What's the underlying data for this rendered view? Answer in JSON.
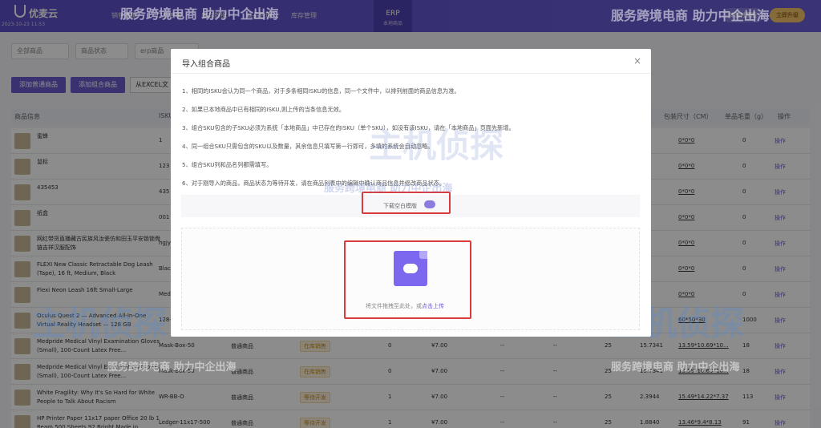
{
  "app": {
    "logo": "优麦云",
    "logo_sub": "2023-10-23 11:53"
  },
  "nav": {
    "items": [
      "销售数据",
      "广告管理",
      "库存数据",
      "商品管理",
      "库存管理"
    ],
    "erp_title": "ERP",
    "erp_sub": "本地商品",
    "right_buttons": [
      "体验付费版",
      "立即升级"
    ]
  },
  "filters": {
    "all_products": "全部商品",
    "product_status": "商品状态",
    "erp_product": "erp商品"
  },
  "actions": {
    "add_normal": "添加普通商品",
    "add_combo": "添加组合商品",
    "import_excel": "从EXCEL文"
  },
  "table": {
    "headers": {
      "info": "商品信息",
      "sku": "ISKU",
      "size": "包装尺寸（CM）",
      "gross": "单品毛重（g）",
      "op": "操作"
    },
    "rows": [
      {
        "name": "蜜蜂",
        "sku": "1",
        "type": "",
        "status": "",
        "qty": "",
        "price": "",
        "d1": "",
        "d2": "",
        "n": "",
        "w": "",
        "size": "0*0*0",
        "gross": "0",
        "op": "操作"
      },
      {
        "name": "鼠标",
        "sku": "123",
        "type": "",
        "status": "",
        "qty": "",
        "price": "",
        "d1": "",
        "d2": "",
        "n": "",
        "w": "",
        "size": "0*0*0",
        "gross": "0",
        "op": "操作"
      },
      {
        "name": "435453",
        "sku": "435",
        "type": "",
        "status": "",
        "qty": "",
        "price": "",
        "d1": "",
        "d2": "",
        "n": "",
        "w": "",
        "size": "0*0*0",
        "gross": "0",
        "op": "操作"
      },
      {
        "name": "纸盒",
        "sku": "001",
        "type": "",
        "status": "",
        "qty": "",
        "price": "",
        "d1": "",
        "d2": "",
        "n": "",
        "w": "",
        "size": "0*0*0",
        "gross": "0",
        "op": "操作"
      },
      {
        "name": "网红带货直播藏古民族风汝瓷仿和田玉平安锁锁骨链吉祥汉服配饰",
        "sku": "hgjy",
        "type": "",
        "status": "",
        "qty": "",
        "price": "",
        "d1": "",
        "d2": "",
        "n": "",
        "w": "",
        "size": "0*0*0",
        "gross": "0",
        "op": "操作"
      },
      {
        "name": "FLEXI New Classic Retractable Dog Leash (Tape), 16 ft, Medium, Black",
        "sku": "Black",
        "type": "",
        "status": "",
        "qty": "",
        "price": "",
        "d1": "",
        "d2": "",
        "n": "",
        "w": "",
        "size": "0*0*0",
        "gross": "0",
        "op": "操作"
      },
      {
        "name": "Flexi Neon Leash 16ft Small-Large",
        "sku": "Med",
        "type": "",
        "status": "",
        "qty": "",
        "price": "",
        "d1": "",
        "d2": "",
        "n": "",
        "w": "",
        "size": "0*0*0",
        "gross": "0",
        "op": "操作"
      },
      {
        "name": "Oculus Quest 2 — Advanced All-In-One Virtual Reality Headset — 128 GB",
        "sku": "128-",
        "type": "",
        "status": "",
        "qty": "",
        "price": "",
        "d1": "",
        "d2": "",
        "n": "",
        "w": "",
        "size": "60*50*30",
        "gross": "1000",
        "op": "操作"
      },
      {
        "name": "Medpride Medical Vinyl Examination Gloves (Small), 100-Count Latex Free...",
        "sku": "Mask-Box-50",
        "type": "普通商品",
        "status": "在库销售",
        "qty": "0",
        "price": "¥7.00",
        "d1": "--",
        "d2": "--",
        "n": "25",
        "w": "15.7341",
        "size": "13.59*10.69*10...",
        "gross": "18",
        "op": "操作"
      },
      {
        "name": "Medpride Medical Vinyl Examination Gloves (Small), 100-Count Latex Free...",
        "sku": "Mask-Box-50",
        "type": "普通商品",
        "status": "在库销售",
        "qty": "0",
        "price": "¥7.00",
        "d1": "--",
        "d2": "--",
        "n": "25",
        "w": "15.7341",
        "size": "13.59*10.69*10...",
        "gross": "18",
        "op": "操作"
      },
      {
        "name": "White Fragility: Why It's So Hard for White People to Talk About Racism",
        "sku": "WR-BB-O",
        "type": "普通商品",
        "status": "等待开发",
        "qty": "1",
        "price": "¥7.00",
        "d1": "--",
        "d2": "--",
        "n": "25",
        "w": "2.3944",
        "size": "15.49*14.22*7.37",
        "gross": "113",
        "op": "操作"
      },
      {
        "name": "HP Printer Paper 11x17 paper Office 20 lb 1 Ream 500 Sheets 92 Bright Made in...",
        "sku": "Ledger-11x17-500",
        "type": "普通商品",
        "status": "等待开发",
        "qty": "1",
        "price": "¥7.00",
        "d1": "--",
        "d2": "--",
        "n": "25",
        "w": "1.8840",
        "size": "13.46*9.4*8.13",
        "gross": "91",
        "op": "操作"
      }
    ]
  },
  "modal": {
    "title": "导入组合商品",
    "close": "×",
    "notes": [
      "1、相同的ISKU会认为同一个商品，对于多条相同ISKU的信息，同一个文件中，以排列前面的商品信息为准。",
      "2、如果已本地商品中已有相同的ISKU,则上传的当条信息无效。",
      "3、组合SKU包含的子SKU必须为系统「本地商品」中已存在的ISKU（单个SKU），如没有该ISKU，请在「本地商品」页面先新增。",
      "4、同一组合SKU只需包含的SKU以及数量，其余信息只填写第一行即可，多填的系统会自动忽略。",
      "5、组合SKU列和品名列都需填写。",
      "6、对于刚导入的商品，商品状态为等待开发，请在商品列表中的编辑中确认商品信息并修改商品状态。"
    ],
    "download_template": "下载空白模版",
    "upload_hint": "将文件拖拽至此处，或",
    "upload_link": "点击上传"
  },
  "watermark": {
    "text_small": "服务跨境电商 助力中企出海",
    "text_big": "主机侦探"
  }
}
